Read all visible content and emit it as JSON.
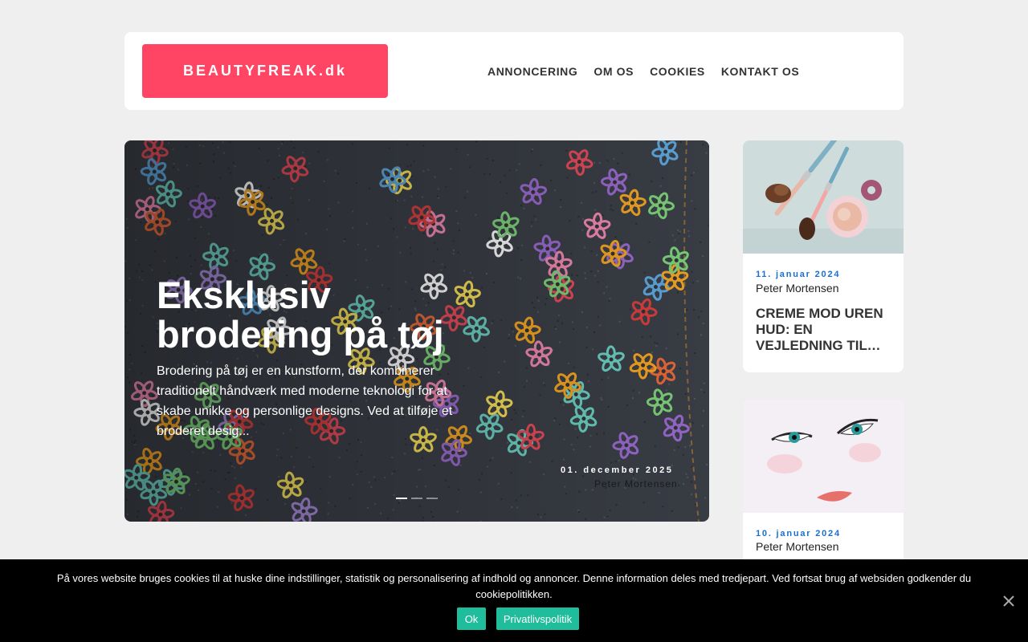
{
  "header": {
    "logo_text": "BEAUTYFREAK.dk",
    "nav": [
      "ANNONCERING",
      "OM OS",
      "COOKIES",
      "KONTAKT OS"
    ]
  },
  "hero": {
    "title": "Eksklusiv brodering på tøj",
    "excerpt": "Brodering på tøj er en kunstform, der kombinerer traditionelt håndværk med moderne teknologi for at skabe unikke og personlige designs. Ved at tilføje et broderet desig...",
    "date": "01. december 2025",
    "author": "Peter Mortensen",
    "slides": 3,
    "active_slide": 1
  },
  "cards": [
    {
      "date": "11. januar 2024",
      "author": "Peter Mortensen",
      "title": "CREME MOD UREN HUD: EN VEJLEDNING TIL EFFEKTIV HUDPLEJE"
    },
    {
      "date": "10. januar 2024",
      "author": "Peter Mortensen",
      "title": ""
    }
  ],
  "cookie": {
    "text": "På vores website bruges cookies til at huske dine indstillinger, statistik og personalisering af indhold og annoncer. Denne information deles med tredjepart. Ved fortsat brug af websiden godkender du cookiepolitikken.",
    "ok_label": "Ok",
    "privacy_label": "Privatlivspolitik"
  },
  "colors": {
    "brand": "#ff4563",
    "link_date": "#1a6fd1",
    "cookie_button": "#1fbd9b"
  }
}
